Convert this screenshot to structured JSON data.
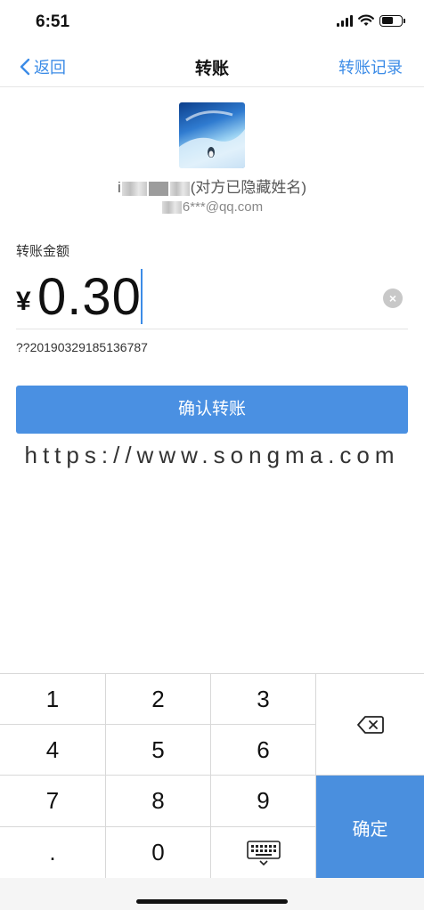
{
  "status_bar": {
    "time": "6:51"
  },
  "nav": {
    "back_label": "返回",
    "title": "转账",
    "right_label": "转账记录"
  },
  "recipient": {
    "name_prefix": "i",
    "name_suffix": "(对方已隐藏姓名)",
    "account_prefix": "",
    "account_suffix": "6***@qq.com"
  },
  "amount": {
    "label": "转账金额",
    "currency": "¥",
    "value": "0.30",
    "memo": "??20190329185136787"
  },
  "confirm_button": "确认转账",
  "watermark": "https://www.songma.com",
  "keypad": {
    "keys": [
      "1",
      "2",
      "3",
      "4",
      "5",
      "6",
      "7",
      "8",
      "9",
      ".",
      "0"
    ],
    "submit_label": "确定"
  },
  "colors": {
    "accent": "#3c8ce7",
    "button": "#4a90e2",
    "keypad_submit": "#4a8fde"
  }
}
